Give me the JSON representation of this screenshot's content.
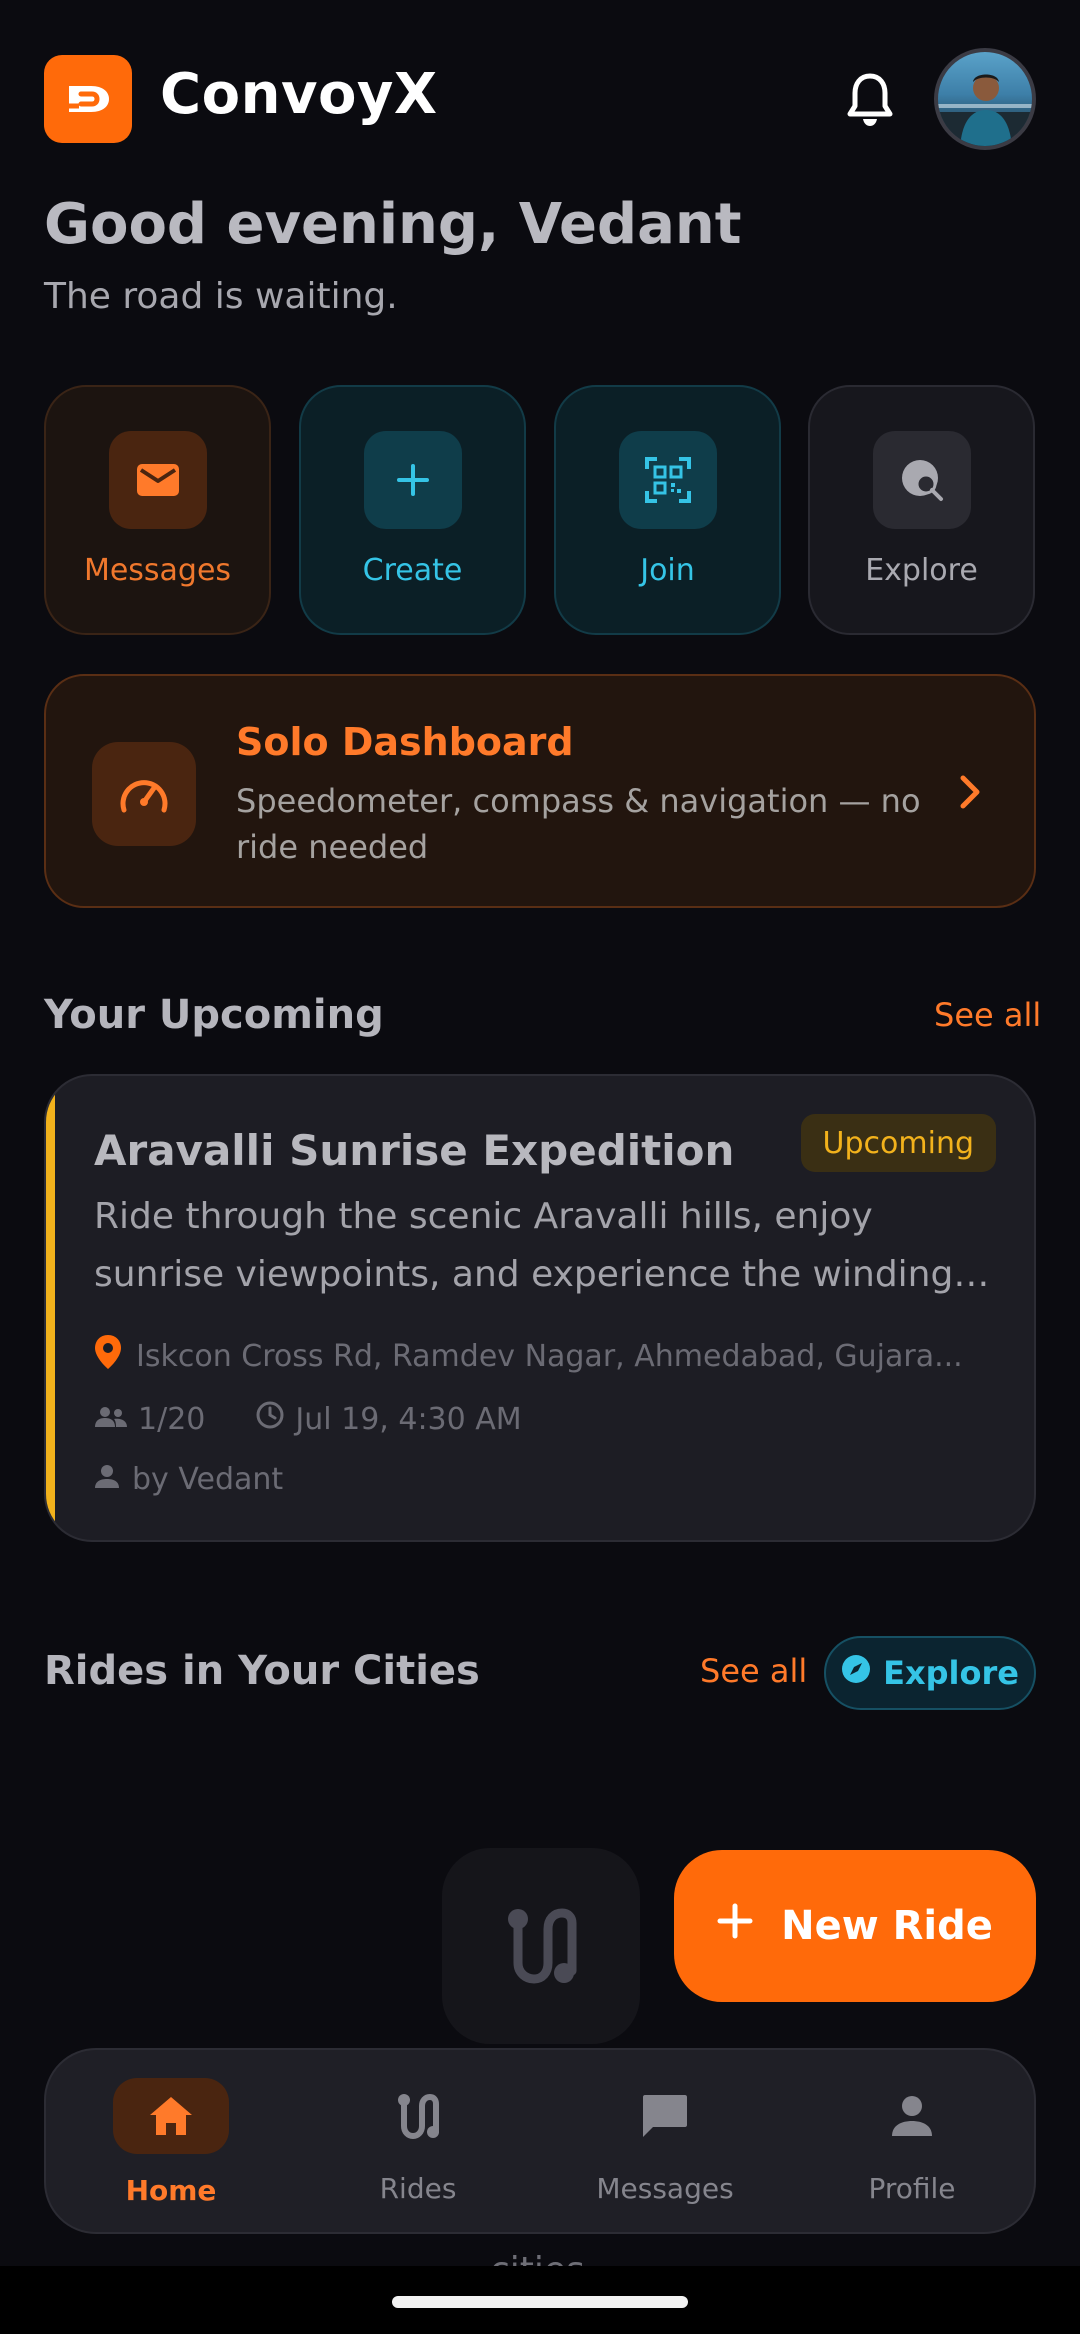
{
  "header": {
    "app_title": "ConvoyX",
    "notifications_icon": "bell-icon",
    "avatar_icon": "user-avatar"
  },
  "greeting": {
    "title": "Good evening, Vedant",
    "subtitle": "The road is waiting."
  },
  "quick_actions": [
    {
      "label": "Messages",
      "icon": "mail-icon"
    },
    {
      "label": "Create",
      "icon": "plus-icon"
    },
    {
      "label": "Join",
      "icon": "qr-scan-icon"
    },
    {
      "label": "Explore",
      "icon": "globe-search-icon"
    }
  ],
  "solo_dashboard": {
    "title": "Solo Dashboard",
    "description": "Speedometer, compass & navigation — no ride needed"
  },
  "upcoming": {
    "section_title": "Your Upcoming",
    "see_all": "See all",
    "ride": {
      "title": "Aravalli Sunrise Expedition",
      "status": "Upcoming",
      "description": "Ride through the scenic Aravalli hills, enjoy sunrise viewpoints, and experience the winding…",
      "location": "Iskcon Cross Rd, Ramdev Nagar, Ahmedabad, Gujara...",
      "participants": "1/20",
      "datetime": "Jul 19, 4:30 AM",
      "organizer": "by Vedant"
    }
  },
  "cities": {
    "section_title": "Rides in Your Cities",
    "see_all": "See all",
    "explore_label": "Explore"
  },
  "fab": {
    "new_ride_label": "New Ride"
  },
  "bottom_nav": {
    "items": [
      {
        "label": "Home",
        "icon": "home-icon",
        "active": true
      },
      {
        "label": "Rides",
        "icon": "route-icon",
        "active": false
      },
      {
        "label": "Messages",
        "icon": "chat-icon",
        "active": false
      },
      {
        "label": "Profile",
        "icon": "person-icon",
        "active": false
      }
    ]
  },
  "partial_text": "cities",
  "colors": {
    "accent": "#ff6a0a",
    "cyan": "#35c4e6",
    "amber": "#f2b21c",
    "background": "#0b0b10"
  }
}
